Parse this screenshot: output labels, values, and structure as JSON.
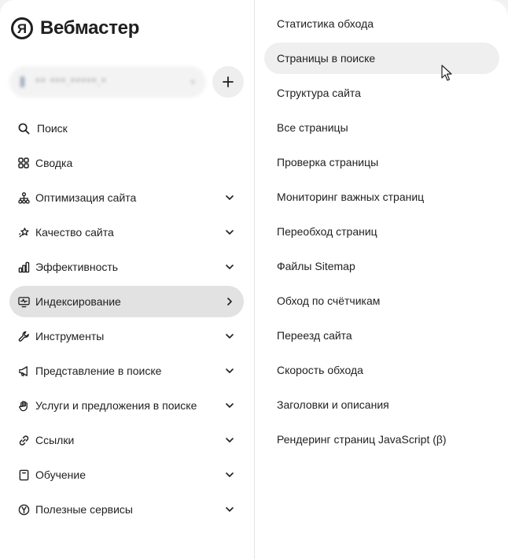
{
  "app": {
    "logo_letter": "Я",
    "title": "Вебмастер"
  },
  "site_selector": {
    "value": "** ***.*****.*"
  },
  "menu": [
    {
      "label": "Поиск",
      "icon": "search-icon",
      "chevron": "none"
    },
    {
      "label": "Сводка",
      "icon": "grid-icon",
      "chevron": "none"
    },
    {
      "label": "Оптимизация сайта",
      "icon": "sitemap-icon",
      "chevron": "down"
    },
    {
      "label": "Качество сайта",
      "icon": "sparkle-star-icon",
      "chevron": "down"
    },
    {
      "label": "Эффективность",
      "icon": "bar-chart-icon",
      "chevron": "down"
    },
    {
      "label": "Индексирование",
      "icon": "monitor-pulse-icon",
      "chevron": "right",
      "active": true
    },
    {
      "label": "Инструменты",
      "icon": "wrench-icon",
      "chevron": "down"
    },
    {
      "label": "Представление в поиске",
      "icon": "megaphone-icon",
      "chevron": "down"
    },
    {
      "label": "Услуги и предложения в поиске",
      "icon": "hand-icon",
      "chevron": "down"
    },
    {
      "label": "Ссылки",
      "icon": "link-icon",
      "chevron": "down"
    },
    {
      "label": "Обучение",
      "icon": "book-icon",
      "chevron": "down"
    },
    {
      "label": "Полезные сервисы",
      "icon": "yandex-circle-icon",
      "chevron": "down"
    }
  ],
  "submenu": [
    {
      "label": "Статистика обхода"
    },
    {
      "label": "Страницы в поиске",
      "hover": true
    },
    {
      "label": "Структура сайта"
    },
    {
      "label": "Все страницы"
    },
    {
      "label": "Проверка страницы"
    },
    {
      "label": "Мониторинг важных страниц"
    },
    {
      "label": "Переобход страниц"
    },
    {
      "label": "Файлы Sitemap"
    },
    {
      "label": "Обход по счётчикам"
    },
    {
      "label": "Переезд сайта"
    },
    {
      "label": "Скорость обхода"
    },
    {
      "label": "Заголовки и описания"
    },
    {
      "label": "Рендеринг страниц JavaScript (β)"
    }
  ],
  "colors": {
    "active_bg": "#e2e2e2",
    "hover_bg": "#efefef",
    "text": "#1f1f1f"
  }
}
